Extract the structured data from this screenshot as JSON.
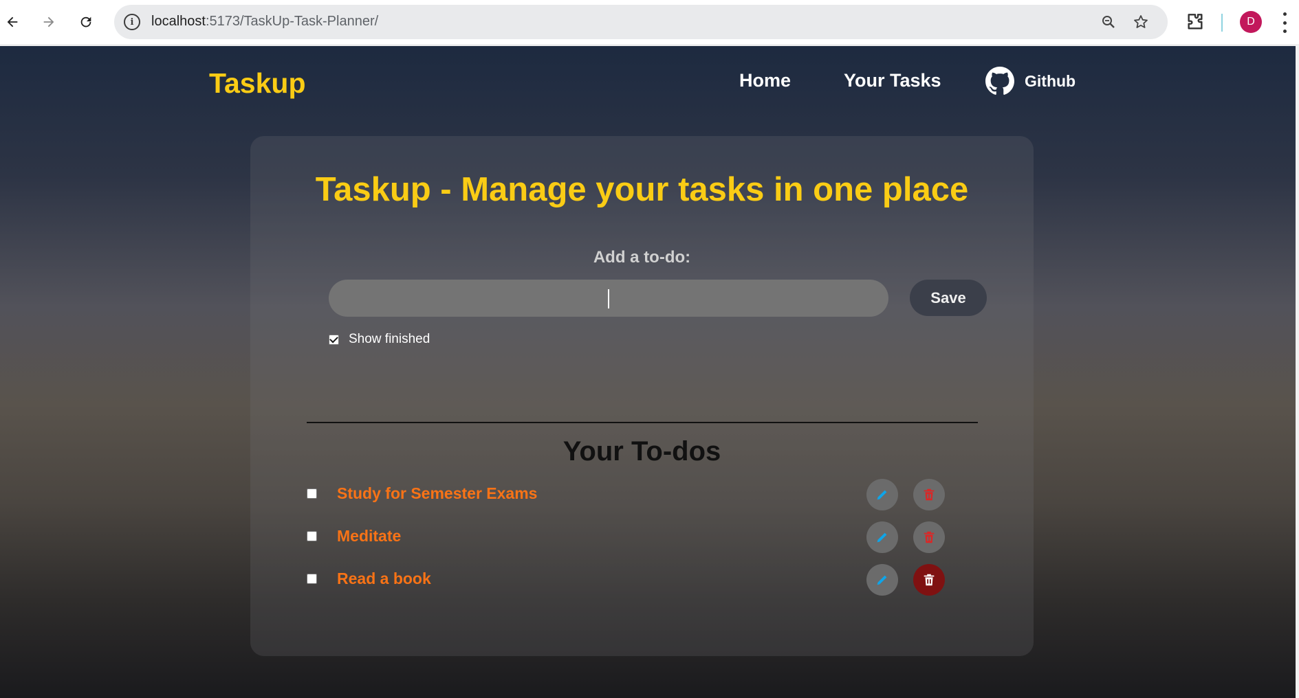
{
  "browser": {
    "url_host": "localhost",
    "url_path": ":5173/TaskUp-Task-Planner/",
    "profile_initial": "D",
    "icons": [
      "back-arrow-icon",
      "forward-arrow-icon",
      "reload-icon",
      "site-info-icon",
      "zoom-icon",
      "bookmark-star-icon",
      "extensions-icon",
      "more-menu-icon"
    ]
  },
  "navbar": {
    "brand": "Taskup",
    "links": [
      "Home",
      "Your Tasks"
    ],
    "github_label": "Github"
  },
  "main": {
    "title": "Taskup - Manage your tasks in one place",
    "add_label": "Add a to-do:",
    "input_value": "",
    "save_label": "Save",
    "show_finished_label": "Show finished",
    "show_finished_checked": true,
    "section_title": "Your To-dos",
    "todos": [
      {
        "text": "Study for Semester Exams",
        "done": false
      },
      {
        "text": "Meditate",
        "done": false
      },
      {
        "text": "Read a book",
        "done": false
      }
    ]
  },
  "colors": {
    "brand": "#facc15",
    "todo_text": "#f97316",
    "edit_icon": "#0ea5e9",
    "delete_icon": "#dc2626",
    "delete_active_bg": "#7f1111"
  }
}
